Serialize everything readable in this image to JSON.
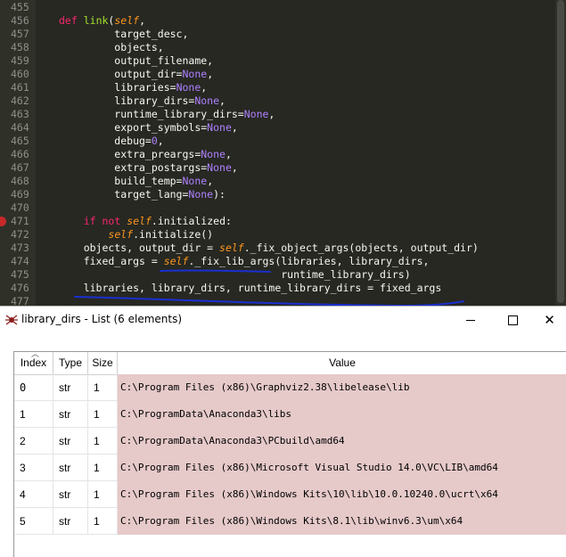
{
  "editor": {
    "lines": [
      {
        "num": "455",
        "html": ""
      },
      {
        "num": "456",
        "html": "<span class=\"kw\">def</span> <span class=\"fn\">link</span>(<span class=\"sf\">self</span>,"
      },
      {
        "num": "457",
        "html": "         target_desc,"
      },
      {
        "num": "458",
        "html": "         objects,"
      },
      {
        "num": "459",
        "html": "         output_filename,"
      },
      {
        "num": "460",
        "html": "         output_dir=<span class=\"cn\">None</span>,"
      },
      {
        "num": "461",
        "html": "         libraries=<span class=\"cn\">None</span>,"
      },
      {
        "num": "462",
        "html": "         library_dirs=<span class=\"cn\">None</span>,"
      },
      {
        "num": "463",
        "html": "         runtime_library_dirs=<span class=\"cn\">None</span>,"
      },
      {
        "num": "464",
        "html": "         export_symbols=<span class=\"cn\">None</span>,"
      },
      {
        "num": "465",
        "html": "         debug=<span class=\"cn\">0</span>,"
      },
      {
        "num": "466",
        "html": "         extra_preargs=<span class=\"cn\">None</span>,"
      },
      {
        "num": "467",
        "html": "         extra_postargs=<span class=\"cn\">None</span>,"
      },
      {
        "num": "468",
        "html": "         build_temp=<span class=\"cn\">None</span>,"
      },
      {
        "num": "469",
        "html": "         target_lang=<span class=\"cn\">None</span>):"
      },
      {
        "num": "470",
        "html": ""
      },
      {
        "num": "471",
        "html": "    <span class=\"kw\">if</span> <span class=\"kw\">not</span> <span class=\"sf\">self</span>.initialized:"
      },
      {
        "num": "472",
        "html": "        <span class=\"sf\">self</span>.initialize()"
      },
      {
        "num": "473",
        "html": "    objects, output_dir = <span class=\"sf\">self</span>._fix_object_args(objects, output_dir)"
      },
      {
        "num": "474",
        "html": "    fixed_args = <span class=\"sf\">self</span>._fix_lib_args(libraries, library_dirs,"
      },
      {
        "num": "475",
        "html": "                                    runtime_library_dirs)"
      },
      {
        "num": "476",
        "html": "    libraries, library_dirs, runtime_library_dirs = fixed_args"
      },
      {
        "num": "477",
        "html": ""
      }
    ],
    "breakpoint_line": "471"
  },
  "dialog": {
    "title": "library_dirs - List (6 elements)",
    "close_glyph": "✕",
    "columns": {
      "index": "Index",
      "type": "Type",
      "size": "Size",
      "value": "Value"
    },
    "rows": [
      {
        "index": "0",
        "type": "str",
        "size": "1",
        "value": "C:\\Program Files (x86)\\Graphviz2.38\\libelease\\lib"
      },
      {
        "index": "1",
        "type": "str",
        "size": "1",
        "value": "C:\\ProgramData\\Anaconda3\\libs"
      },
      {
        "index": "2",
        "type": "str",
        "size": "1",
        "value": "C:\\ProgramData\\Anaconda3\\PCbuild\\amd64"
      },
      {
        "index": "3",
        "type": "str",
        "size": "1",
        "value": "C:\\Program Files (x86)\\Microsoft Visual Studio 14.0\\VC\\LIB\\amd64"
      },
      {
        "index": "4",
        "type": "str",
        "size": "1",
        "value": "C:\\Program Files (x86)\\Windows Kits\\10\\lib\\10.0.10240.0\\ucrt\\x64"
      },
      {
        "index": "5",
        "type": "str",
        "size": "1",
        "value": "C:\\Program Files (x86)\\Windows Kits\\8.1\\lib\\winv6.3\\um\\x64"
      }
    ]
  },
  "colors": {
    "editor_bg": "#272822",
    "value_cell_bg": "#e6c9c9",
    "annotation_ink": "#1a2fd0",
    "breakpoint": "#c62828"
  }
}
